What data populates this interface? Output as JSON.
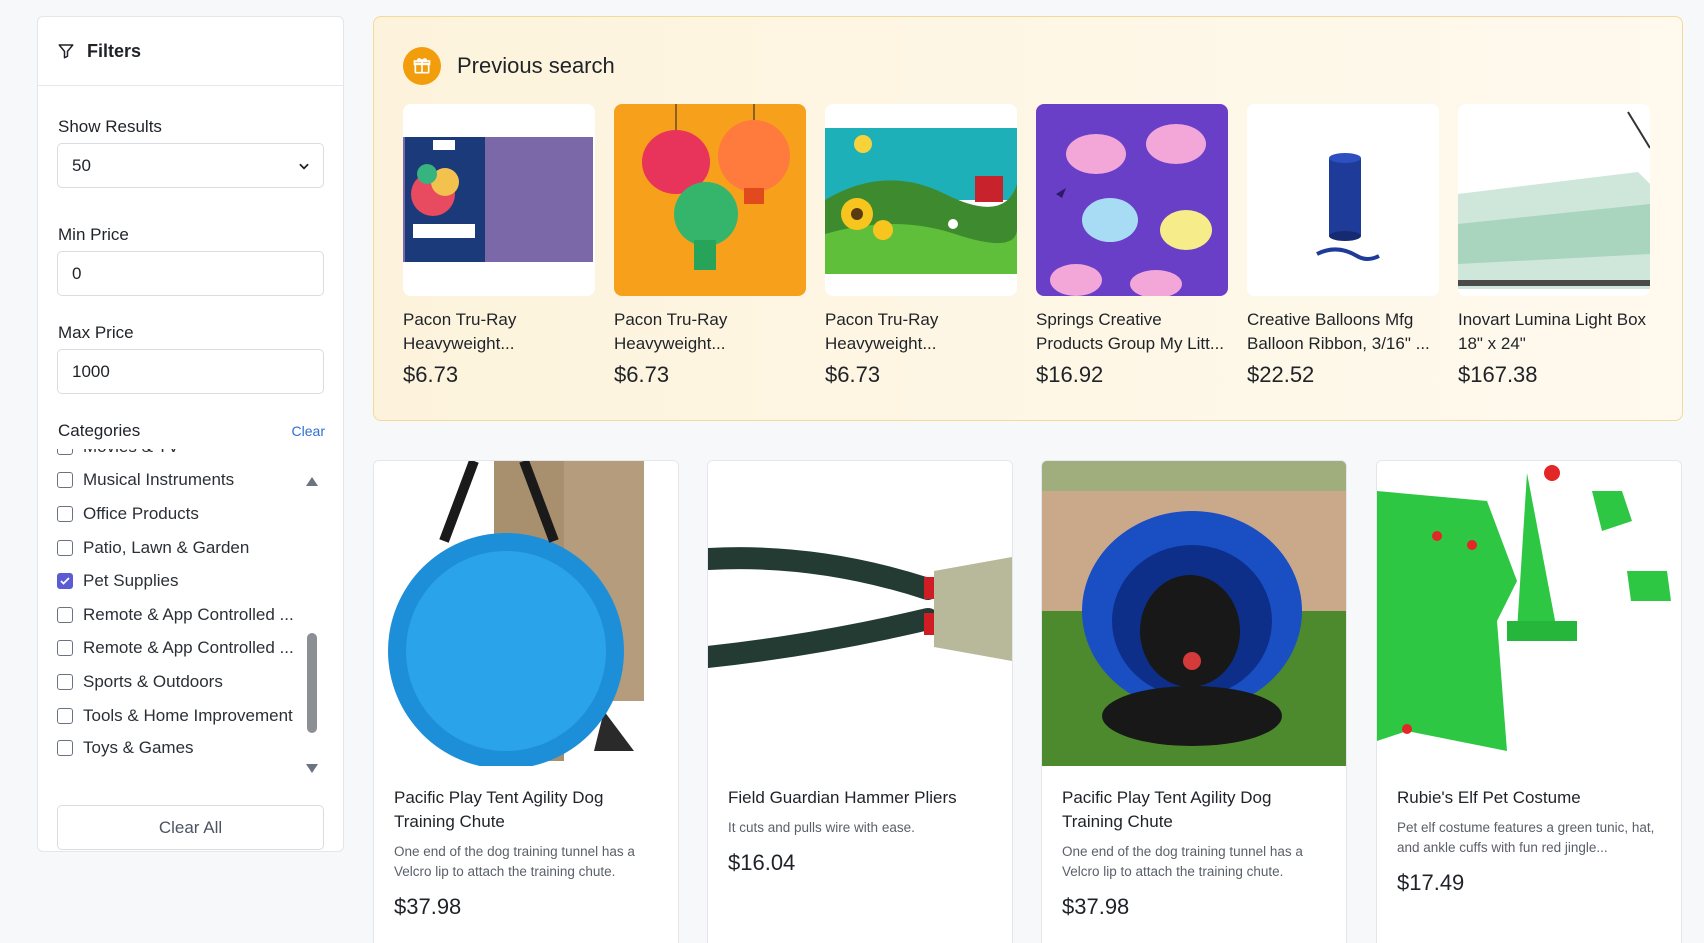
{
  "filters": {
    "title": "Filters",
    "show_results_label": "Show Results",
    "show_results_value": "50",
    "min_price_label": "Min Price",
    "min_price_value": "0",
    "max_price_label": "Max Price",
    "max_price_value": "1000",
    "categories_label": "Categories",
    "clear_label": "Clear",
    "clear_all_label": "Clear All",
    "categories": [
      {
        "label": "Movies & TV",
        "checked": false
      },
      {
        "label": "Musical Instruments",
        "checked": false
      },
      {
        "label": "Office Products",
        "checked": false
      },
      {
        "label": "Patio, Lawn & Garden",
        "checked": false
      },
      {
        "label": "Pet Supplies",
        "checked": true
      },
      {
        "label": "Remote & App Controlled ...",
        "checked": false
      },
      {
        "label": "Remote & App Controlled ...",
        "checked": false
      },
      {
        "label": "Sports & Outdoors",
        "checked": false
      },
      {
        "label": "Tools & Home Improvement",
        "checked": false
      },
      {
        "label": "Toys & Games",
        "checked": false
      }
    ]
  },
  "previous_search": {
    "title": "Previous search",
    "items": [
      {
        "title": "Pacon Tru-Ray Heavyweight...",
        "price": "$6.73"
      },
      {
        "title": "Pacon Tru-Ray Heavyweight...",
        "price": "$6.73"
      },
      {
        "title": "Pacon Tru-Ray Heavyweight...",
        "price": "$6.73"
      },
      {
        "title": "Springs Creative Products Group My Litt...",
        "price": "$16.92"
      },
      {
        "title": "Creative Balloons Mfg Balloon Ribbon, 3/16\" ...",
        "price": "$22.52"
      },
      {
        "title": "Inovart Lumina Light Box 18\" x 24\"",
        "price": "$167.38"
      }
    ]
  },
  "products": [
    {
      "title": "Pacific Play Tent Agility Dog Training Chute",
      "desc": "One end of the dog training tunnel has a Velcro lip to attach the training chute.",
      "price": "$37.98"
    },
    {
      "title": "Field Guardian Hammer Pliers",
      "desc": "It cuts and pulls wire with ease.",
      "price": "$16.04"
    },
    {
      "title": "Pacific Play Tent Agility Dog Training Chute",
      "desc": "One end of the dog training tunnel has a Velcro lip to attach the training chute.",
      "price": "$37.98"
    },
    {
      "title": "Rubie's Elf Pet Costume",
      "desc": "Pet elf costume features a green tunic, hat, and ankle cuffs with fun red jingle...",
      "price": "$17.49"
    }
  ],
  "colors": {
    "accent": "#f29e0c",
    "link": "#2f6fd1",
    "checkbox": "#5b5bd6"
  }
}
